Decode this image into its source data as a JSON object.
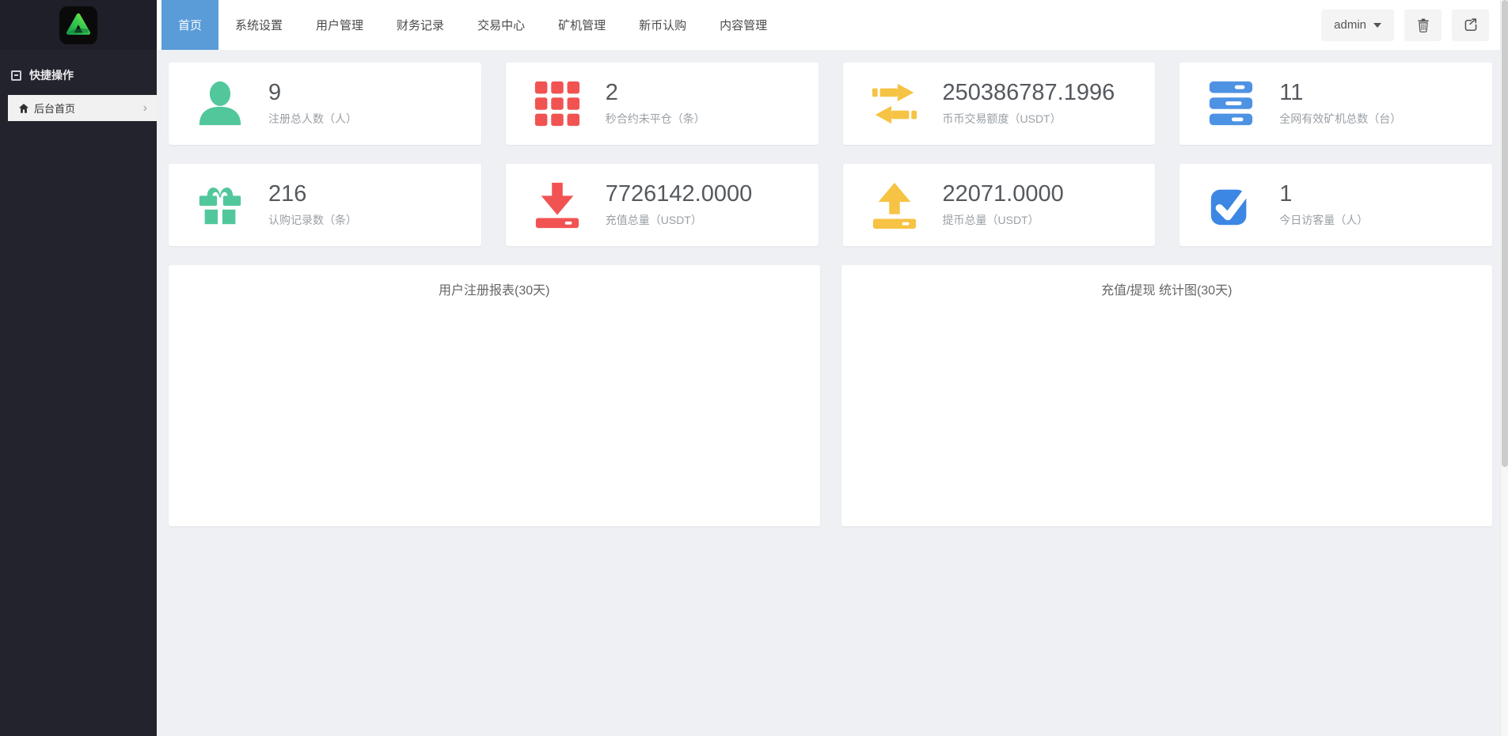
{
  "app": {
    "logo_name": "brand-a-logo"
  },
  "sidebar": {
    "section_title": "快捷操作",
    "items": [
      {
        "icon": "home-icon",
        "label": "后台首页",
        "chevron": "›"
      }
    ]
  },
  "navbar": {
    "tabs": [
      {
        "label": "首页",
        "active": true
      },
      {
        "label": "系统设置",
        "active": false
      },
      {
        "label": "用户管理",
        "active": false
      },
      {
        "label": "财务记录",
        "active": false
      },
      {
        "label": "交易中心",
        "active": false
      },
      {
        "label": "矿机管理",
        "active": false
      },
      {
        "label": "新币认购",
        "active": false
      },
      {
        "label": "内容管理",
        "active": false
      }
    ],
    "user": {
      "name": "admin"
    },
    "buttons": [
      {
        "icon": "trash-icon"
      },
      {
        "icon": "logout-icon"
      }
    ],
    "active_tab_color": "#5a9cd8"
  },
  "stats": [
    {
      "icon": "user-icon",
      "color": "#52c79c",
      "value": "9",
      "label": "注册总人数（人）"
    },
    {
      "icon": "grid-icon",
      "color": "#f15353",
      "value": "2",
      "label": "秒合约未平仓（条）"
    },
    {
      "icon": "exchange-icon",
      "color": "#f6c344",
      "value": "250386787.1996",
      "label": "币币交易额度（USDT）"
    },
    {
      "icon": "server-icon",
      "color": "#4e92e4",
      "value": "11",
      "label": "全网有效矿机总数（台）"
    },
    {
      "icon": "gift-icon",
      "color": "#52c79c",
      "value": "216",
      "label": "认购记录数（条）"
    },
    {
      "icon": "download-icon",
      "color": "#f15353",
      "value": "7726142.0000",
      "label": "充值总量（USDT）"
    },
    {
      "icon": "upload-icon",
      "color": "#f6c344",
      "value": "22071.0000",
      "label": "提币总量（USDT）"
    },
    {
      "icon": "check-icon",
      "color": "#3c86e4",
      "value": "1",
      "label": "今日访客量（人）"
    }
  ],
  "panels": [
    {
      "title": "用户注册报表(30天)"
    },
    {
      "title": "充值/提现 统计图(30天)"
    }
  ],
  "colors": {
    "sidebar_bg": "#23232d",
    "content_bg": "#eef0f4",
    "active_tab": "#5a9cd8",
    "green": "#52c79c",
    "red": "#f15353",
    "yellow": "#f6c344",
    "blue": "#4e92e4"
  }
}
